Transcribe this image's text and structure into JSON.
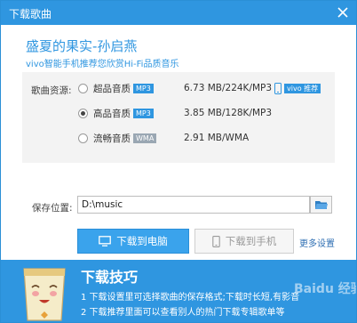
{
  "window": {
    "title": "下载歌曲"
  },
  "song": {
    "title": "盛夏的果实-孙启燕",
    "subtitle": "vivo智能手机推荐您欣赏Hi-Fi品质音乐"
  },
  "quality": {
    "label": "歌曲资源:",
    "options": [
      {
        "name": "超品音质",
        "badge": "MP3",
        "badge_color": "#2f96e0",
        "size": "6.73 MB/224K/MP3",
        "selected": false,
        "vivo_tag": "vivo 推荐"
      },
      {
        "name": "高品音质",
        "badge": "MP3",
        "badge_color": "#2f96e0",
        "size": "3.85 MB/128K/MP3",
        "selected": true
      },
      {
        "name": "流畅音质",
        "badge": "WMA",
        "badge_color": "#9aa7b3",
        "size": "2.91 MB/WMA",
        "selected": false
      }
    ]
  },
  "save": {
    "label": "保存位置:",
    "path": "D:\\music"
  },
  "buttons": {
    "download_pc": "下载到电脑",
    "download_phone": "下载到手机",
    "more_settings": "更多设置"
  },
  "tips": {
    "title": "下载技巧",
    "line1": "1 下载设置里可选择歌曲的保存格式;下载时长短,有影音",
    "line2": "2 下载推荐里面可以查看别人的热门下载专辑歌单等",
    "watermark": "Baidu 经验"
  },
  "colors": {
    "accent": "#2f96e0",
    "badge_wma": "#9aa7b3"
  }
}
